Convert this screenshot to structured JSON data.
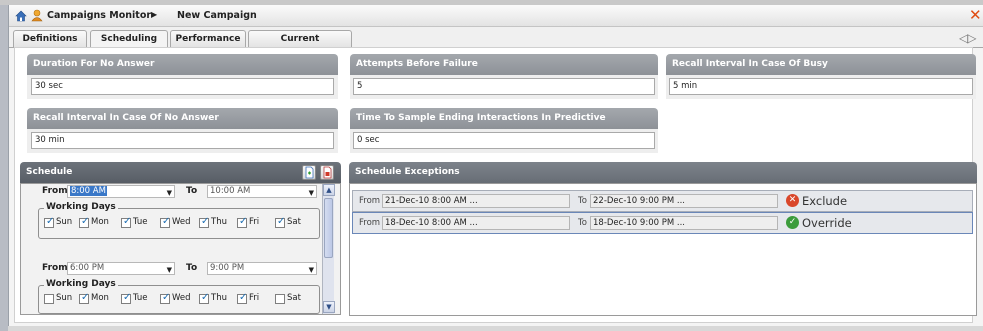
{
  "titlebar": {
    "title": "Campaigns Monitor",
    "separator": "▶",
    "subtitle": "New Campaign",
    "close": "✕"
  },
  "tabs": [
    {
      "label": "Definitions",
      "active": false
    },
    {
      "label": "Scheduling",
      "active": true
    },
    {
      "label": "Performance",
      "active": false
    },
    {
      "label": "Current Interactions",
      "active": false
    }
  ],
  "nav_arrows": "◁|▷",
  "fields": {
    "duration_no_answer": {
      "label": "Duration For No Answer",
      "value": "30",
      "unit": "sec"
    },
    "attempts_before_failure": {
      "label": "Attempts Before Failure",
      "value": "5"
    },
    "recall_busy": {
      "label": "Recall Interval In Case Of Busy",
      "value": "5",
      "unit": "min"
    },
    "recall_no_answer": {
      "label": "Recall Interval In Case Of No Answer",
      "value": "30",
      "unit": "min"
    },
    "time_to_sample": {
      "label": "Time To Sample Ending Interactions In Predictive",
      "value": "0",
      "unit": "sec"
    }
  },
  "schedule": {
    "title": "Schedule",
    "from_label": "From",
    "to_label": "To",
    "working_days_label": "Working Days",
    "entries": [
      {
        "from": "8:00 AM",
        "to": "10:00 AM",
        "days": [
          {
            "name": "Sun",
            "checked": true
          },
          {
            "name": "Mon",
            "checked": true
          },
          {
            "name": "Tue",
            "checked": true
          },
          {
            "name": "Wed",
            "checked": true
          },
          {
            "name": "Thu",
            "checked": true
          },
          {
            "name": "Fri",
            "checked": true
          },
          {
            "name": "Sat",
            "checked": true
          }
        ]
      },
      {
        "from": "6:00 PM",
        "to": "9:00 PM",
        "days": [
          {
            "name": "Sun",
            "checked": false
          },
          {
            "name": "Mon",
            "checked": true
          },
          {
            "name": "Tue",
            "checked": true
          },
          {
            "name": "Wed",
            "checked": true
          },
          {
            "name": "Thu",
            "checked": true
          },
          {
            "name": "Fri",
            "checked": true
          },
          {
            "name": "Sat",
            "checked": false
          }
        ]
      }
    ]
  },
  "exceptions": {
    "title": "Schedule Exceptions",
    "from_label": "From",
    "to_label": "To",
    "rows": [
      {
        "from": "21-Dec-10 8:00 AM ...",
        "to": "22-Dec-10 9:00 PM ...",
        "status": "Exclude",
        "icon": "exclude-icon",
        "color": "#d9472b"
      },
      {
        "from": "18-Dec-10 8:00 AM ...",
        "to": "18-Dec-10 9:00 PM ...",
        "status": "Override",
        "icon": "override-icon",
        "color": "#3c9c3c"
      }
    ]
  },
  "colors": {
    "accent_close": "#e04c12",
    "header_gray": "#8d9197",
    "header_dark": "#575d65"
  }
}
